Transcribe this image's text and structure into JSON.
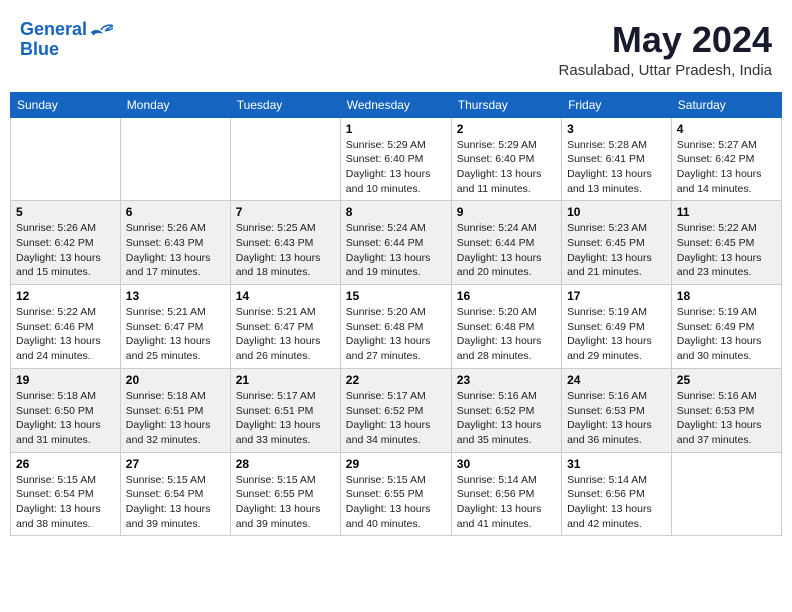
{
  "header": {
    "logo_line1": "General",
    "logo_line2": "Blue",
    "month_year": "May 2024",
    "location": "Rasulabad, Uttar Pradesh, India"
  },
  "weekdays": [
    "Sunday",
    "Monday",
    "Tuesday",
    "Wednesday",
    "Thursday",
    "Friday",
    "Saturday"
  ],
  "weeks": [
    [
      {
        "day": "",
        "info": ""
      },
      {
        "day": "",
        "info": ""
      },
      {
        "day": "",
        "info": ""
      },
      {
        "day": "1",
        "info": "Sunrise: 5:29 AM\nSunset: 6:40 PM\nDaylight: 13 hours\nand 10 minutes."
      },
      {
        "day": "2",
        "info": "Sunrise: 5:29 AM\nSunset: 6:40 PM\nDaylight: 13 hours\nand 11 minutes."
      },
      {
        "day": "3",
        "info": "Sunrise: 5:28 AM\nSunset: 6:41 PM\nDaylight: 13 hours\nand 13 minutes."
      },
      {
        "day": "4",
        "info": "Sunrise: 5:27 AM\nSunset: 6:42 PM\nDaylight: 13 hours\nand 14 minutes."
      }
    ],
    [
      {
        "day": "5",
        "info": "Sunrise: 5:26 AM\nSunset: 6:42 PM\nDaylight: 13 hours\nand 15 minutes."
      },
      {
        "day": "6",
        "info": "Sunrise: 5:26 AM\nSunset: 6:43 PM\nDaylight: 13 hours\nand 17 minutes."
      },
      {
        "day": "7",
        "info": "Sunrise: 5:25 AM\nSunset: 6:43 PM\nDaylight: 13 hours\nand 18 minutes."
      },
      {
        "day": "8",
        "info": "Sunrise: 5:24 AM\nSunset: 6:44 PM\nDaylight: 13 hours\nand 19 minutes."
      },
      {
        "day": "9",
        "info": "Sunrise: 5:24 AM\nSunset: 6:44 PM\nDaylight: 13 hours\nand 20 minutes."
      },
      {
        "day": "10",
        "info": "Sunrise: 5:23 AM\nSunset: 6:45 PM\nDaylight: 13 hours\nand 21 minutes."
      },
      {
        "day": "11",
        "info": "Sunrise: 5:22 AM\nSunset: 6:45 PM\nDaylight: 13 hours\nand 23 minutes."
      }
    ],
    [
      {
        "day": "12",
        "info": "Sunrise: 5:22 AM\nSunset: 6:46 PM\nDaylight: 13 hours\nand 24 minutes."
      },
      {
        "day": "13",
        "info": "Sunrise: 5:21 AM\nSunset: 6:47 PM\nDaylight: 13 hours\nand 25 minutes."
      },
      {
        "day": "14",
        "info": "Sunrise: 5:21 AM\nSunset: 6:47 PM\nDaylight: 13 hours\nand 26 minutes."
      },
      {
        "day": "15",
        "info": "Sunrise: 5:20 AM\nSunset: 6:48 PM\nDaylight: 13 hours\nand 27 minutes."
      },
      {
        "day": "16",
        "info": "Sunrise: 5:20 AM\nSunset: 6:48 PM\nDaylight: 13 hours\nand 28 minutes."
      },
      {
        "day": "17",
        "info": "Sunrise: 5:19 AM\nSunset: 6:49 PM\nDaylight: 13 hours\nand 29 minutes."
      },
      {
        "day": "18",
        "info": "Sunrise: 5:19 AM\nSunset: 6:49 PM\nDaylight: 13 hours\nand 30 minutes."
      }
    ],
    [
      {
        "day": "19",
        "info": "Sunrise: 5:18 AM\nSunset: 6:50 PM\nDaylight: 13 hours\nand 31 minutes."
      },
      {
        "day": "20",
        "info": "Sunrise: 5:18 AM\nSunset: 6:51 PM\nDaylight: 13 hours\nand 32 minutes."
      },
      {
        "day": "21",
        "info": "Sunrise: 5:17 AM\nSunset: 6:51 PM\nDaylight: 13 hours\nand 33 minutes."
      },
      {
        "day": "22",
        "info": "Sunrise: 5:17 AM\nSunset: 6:52 PM\nDaylight: 13 hours\nand 34 minutes."
      },
      {
        "day": "23",
        "info": "Sunrise: 5:16 AM\nSunset: 6:52 PM\nDaylight: 13 hours\nand 35 minutes."
      },
      {
        "day": "24",
        "info": "Sunrise: 5:16 AM\nSunset: 6:53 PM\nDaylight: 13 hours\nand 36 minutes."
      },
      {
        "day": "25",
        "info": "Sunrise: 5:16 AM\nSunset: 6:53 PM\nDaylight: 13 hours\nand 37 minutes."
      }
    ],
    [
      {
        "day": "26",
        "info": "Sunrise: 5:15 AM\nSunset: 6:54 PM\nDaylight: 13 hours\nand 38 minutes."
      },
      {
        "day": "27",
        "info": "Sunrise: 5:15 AM\nSunset: 6:54 PM\nDaylight: 13 hours\nand 39 minutes."
      },
      {
        "day": "28",
        "info": "Sunrise: 5:15 AM\nSunset: 6:55 PM\nDaylight: 13 hours\nand 39 minutes."
      },
      {
        "day": "29",
        "info": "Sunrise: 5:15 AM\nSunset: 6:55 PM\nDaylight: 13 hours\nand 40 minutes."
      },
      {
        "day": "30",
        "info": "Sunrise: 5:14 AM\nSunset: 6:56 PM\nDaylight: 13 hours\nand 41 minutes."
      },
      {
        "day": "31",
        "info": "Sunrise: 5:14 AM\nSunset: 6:56 PM\nDaylight: 13 hours\nand 42 minutes."
      },
      {
        "day": "",
        "info": ""
      }
    ]
  ]
}
